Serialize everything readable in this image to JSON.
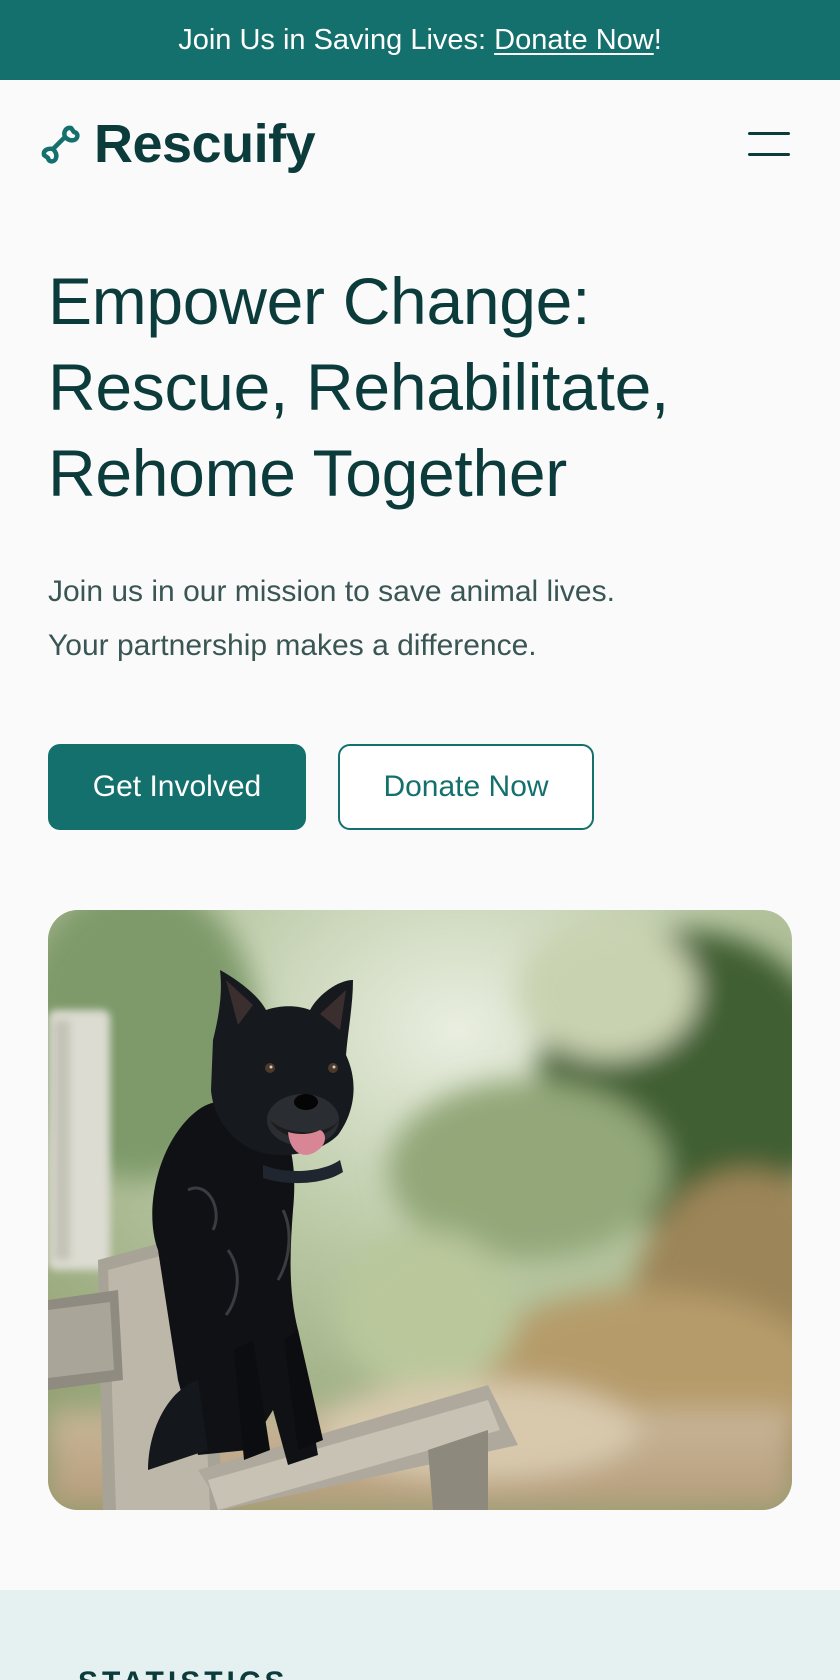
{
  "announcement": {
    "text": "Join Us in Saving Lives: ",
    "link": "Donate Now",
    "suffix": "!"
  },
  "header": {
    "brand": "Rescuify",
    "logo_icon": "bone-icon",
    "menu_icon": "hamburger-menu-icon"
  },
  "hero": {
    "title_lines": [
      "Empower Change:",
      "Rescue, Rehabilitate,",
      "Rehome Together"
    ],
    "subtitle_lines": [
      "Join us in our mission to save animal lives.",
      "Your partnership makes a difference."
    ],
    "primary_cta": "Get Involved",
    "secondary_cta": "Donate Now",
    "image_icon": "dog-photo"
  },
  "stats": {
    "label": "STATISTICS"
  },
  "colors": {
    "brand": "#14706c",
    "ink": "#0b3b3a",
    "band": "#e5f1f1"
  }
}
